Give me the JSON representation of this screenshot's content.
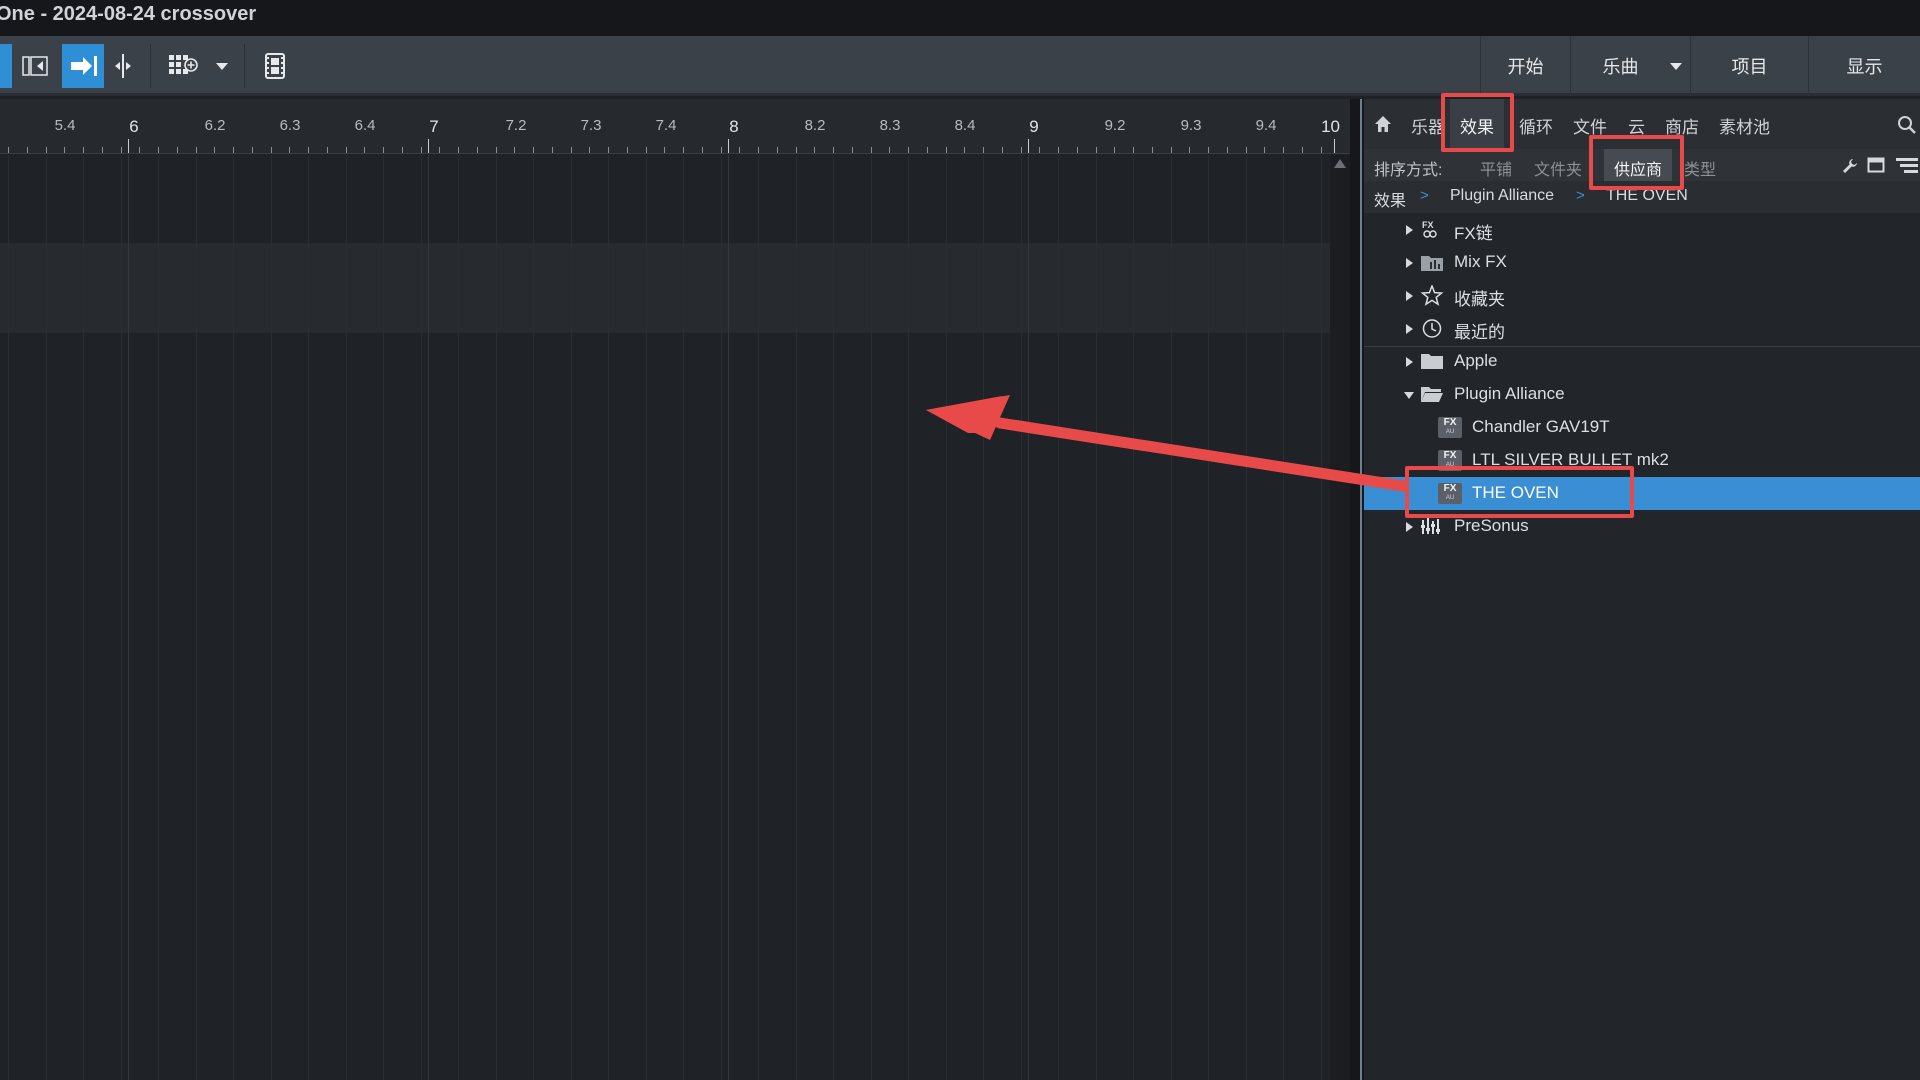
{
  "window": {
    "title": "One - 2024-08-24 crossover"
  },
  "toolbar": {
    "nav": {
      "start": "开始",
      "song": "乐曲",
      "project": "项目",
      "show": "显示"
    }
  },
  "ruler": {
    "labels": [
      "5.4",
      "6",
      "6.2",
      "6.3",
      "6.4",
      "7",
      "7.2",
      "7.3",
      "7.4",
      "8",
      "8.2",
      "8.3",
      "8.4",
      "9",
      "9.2",
      "9.3",
      "9.4",
      "10"
    ]
  },
  "browser": {
    "tabs": {
      "instruments": "乐器",
      "effects": "效果",
      "loops": "循环",
      "files": "文件",
      "cloud": "云",
      "shop": "商店",
      "pool": "素材池"
    },
    "sort": {
      "label": "排序方式:",
      "flat": "平铺",
      "folder": "文件夹",
      "vendor": "供应商",
      "type": "类型"
    },
    "breadcrumb": {
      "root": "效果",
      "vendor": "Plugin Alliance",
      "plugin": "THE OVEN"
    },
    "tree": {
      "fx_chains": "FX链",
      "mix_fx": "Mix FX",
      "favorites": "收藏夹",
      "recent": "最近的",
      "apple": "Apple",
      "plugin_alliance": "Plugin Alliance",
      "chandler": "Chandler GAV19T",
      "ltl": "LTL SILVER BULLET mk2",
      "the_oven": "THE OVEN",
      "presonus": "PreSonus"
    },
    "fx_badge": {
      "top": "FX",
      "bottom": "AU"
    }
  },
  "colors": {
    "accent": "#3a8ed3",
    "highlight": "#e84a4a",
    "background": "#1e2126"
  }
}
